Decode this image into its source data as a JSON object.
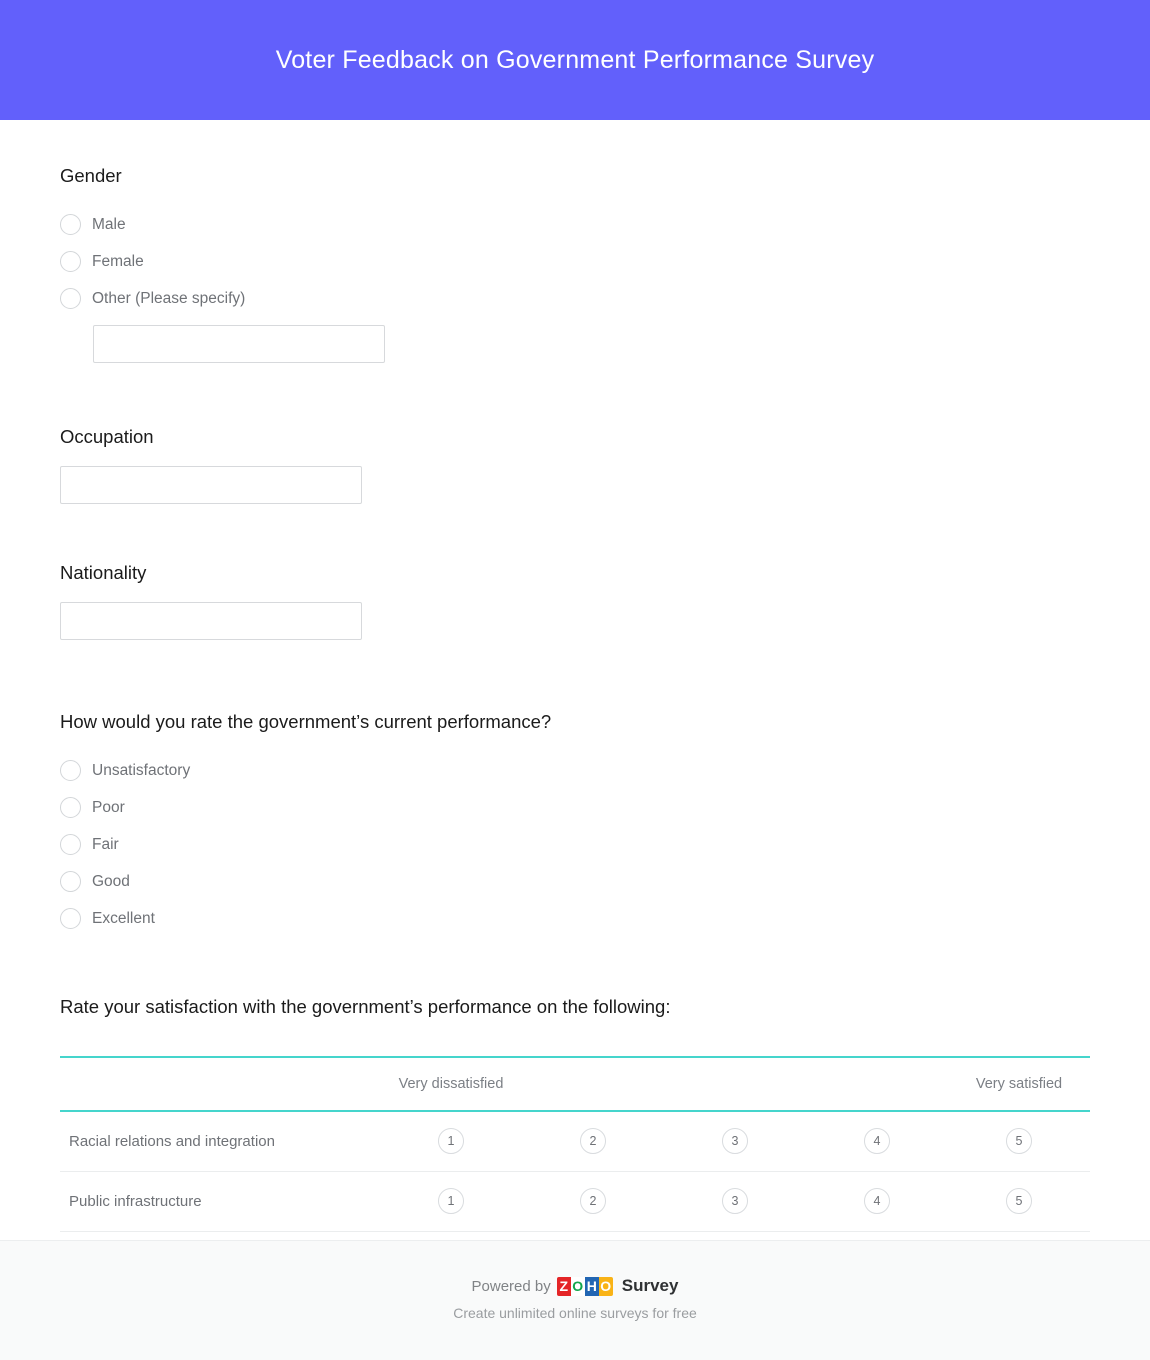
{
  "header": {
    "title": "Voter Feedback on Government Performance Survey",
    "background_color": "#6260fb",
    "text_color": "#ffffff"
  },
  "questions": {
    "gender": {
      "title": "Gender",
      "options": [
        {
          "label": "Male"
        },
        {
          "label": "Female"
        },
        {
          "label": "Other (Please specify)"
        }
      ],
      "other_input_value": "",
      "other_input_placeholder": ""
    },
    "occupation": {
      "title": "Occupation",
      "input_value": "",
      "input_placeholder": ""
    },
    "nationality": {
      "title": "Nationality",
      "input_value": "",
      "input_placeholder": ""
    },
    "performance_rating": {
      "title": "How would you rate the government’s current performance?",
      "options": [
        {
          "label": "Unsatisfactory"
        },
        {
          "label": "Poor"
        },
        {
          "label": "Fair"
        },
        {
          "label": "Good"
        },
        {
          "label": "Excellent"
        }
      ]
    },
    "satisfaction_matrix": {
      "title": "Rate your satisfaction with the government’s performance on the following:",
      "scale_low_label": "Very dissatisfied",
      "scale_high_label": "Very satisfied",
      "scale_values": [
        "1",
        "2",
        "3",
        "4",
        "5"
      ],
      "rows": [
        {
          "label": "Racial relations and integration"
        },
        {
          "label": "Public infrastructure"
        }
      ],
      "divider_color": "#45d5cc"
    }
  },
  "footer": {
    "powered_by_text": "Powered by",
    "brand_letters": [
      "Z",
      "O",
      "H",
      "O"
    ],
    "brand_word": "Survey",
    "tagline": "Create unlimited online surveys for free",
    "brand_colors": {
      "z": "#e42527",
      "o1": "#12a64c",
      "h": "#2266b3",
      "o2": "#f9b316"
    }
  }
}
